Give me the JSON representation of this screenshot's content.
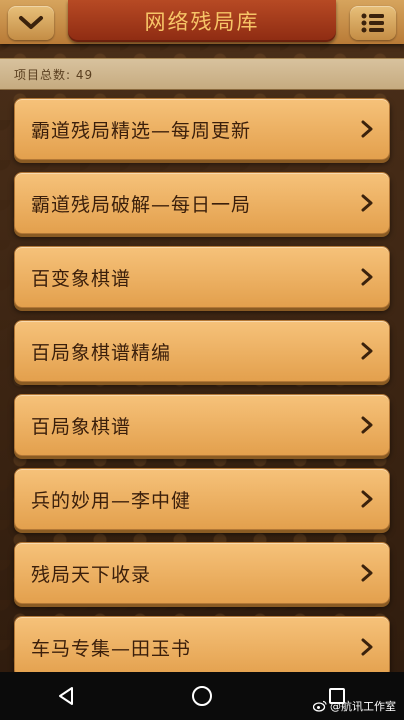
{
  "header": {
    "title": "网络残局库",
    "back_icon": "chevron-down-icon",
    "menu_icon": "list-menu-icon",
    "accent_color": "#8e2b12",
    "title_color": "#f7c567"
  },
  "status": {
    "count_label": "项目总数: 49"
  },
  "items": [
    {
      "label": "霸道残局精选—每周更新",
      "icon": "chevron-right-icon"
    },
    {
      "label": "霸道残局破解—每日一局",
      "icon": "chevron-right-icon"
    },
    {
      "label": "百变象棋谱",
      "icon": "chevron-right-icon"
    },
    {
      "label": "百局象棋谱精编",
      "icon": "chevron-right-icon"
    },
    {
      "label": "百局象棋谱",
      "icon": "chevron-right-icon"
    },
    {
      "label": "兵的妙用—李中健",
      "icon": "chevron-right-icon"
    },
    {
      "label": "残局天下收录",
      "icon": "chevron-right-icon"
    },
    {
      "label": "车马专集—田玉书",
      "icon": "chevron-right-icon"
    }
  ],
  "navbar": {
    "back": "back-triangle-icon",
    "home": "home-circle-icon",
    "recents": "recents-square-icon"
  },
  "watermark": {
    "text": "@航讯工作室",
    "icon": "weibo-icon"
  }
}
